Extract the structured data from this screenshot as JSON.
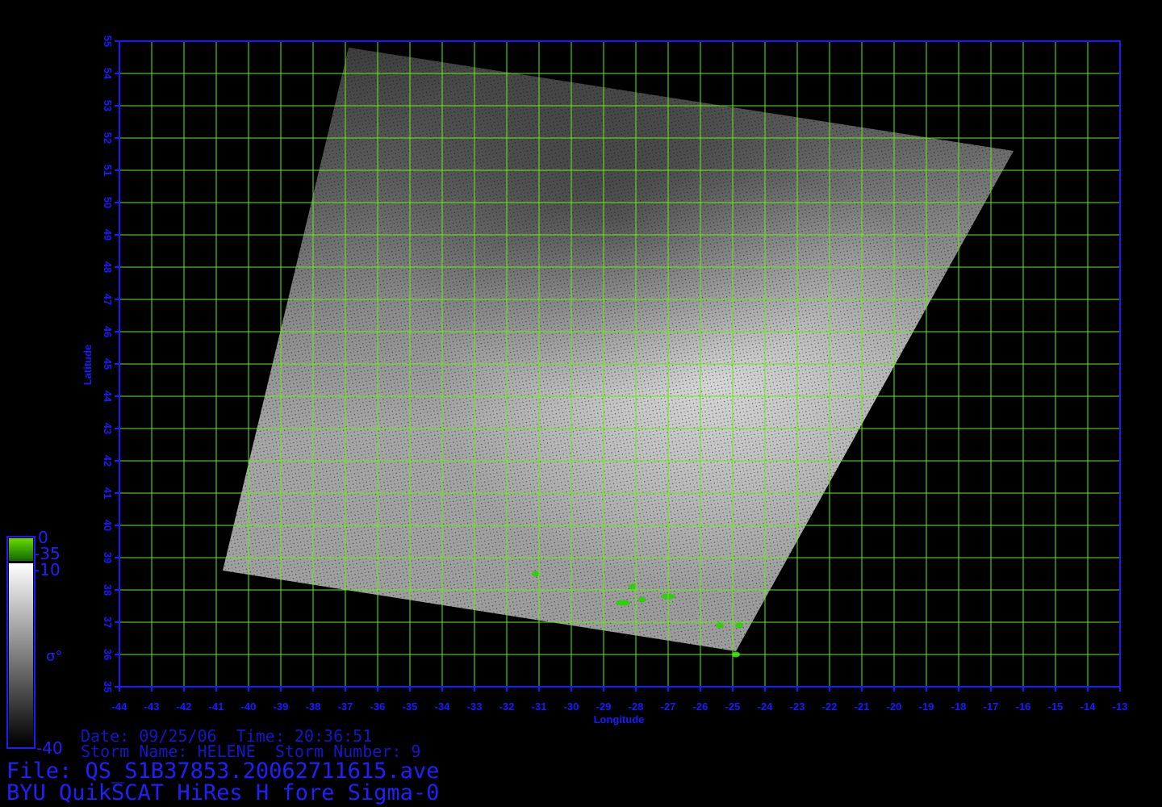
{
  "map": {
    "lon_range": [
      -44,
      -13
    ],
    "lat_range": [
      35,
      55
    ],
    "lon_ticks": [
      -44,
      -43,
      -42,
      -41,
      -40,
      -39,
      -38,
      -37,
      -36,
      -35,
      -34,
      -33,
      -32,
      -31,
      -30,
      -29,
      -28,
      -27,
      -26,
      -25,
      -24,
      -23,
      -22,
      -21,
      -20,
      -19,
      -18,
      -17,
      -16,
      -15,
      -14,
      -13
    ],
    "lat_ticks": [
      35,
      36,
      37,
      38,
      39,
      40,
      41,
      42,
      43,
      44,
      45,
      46,
      47,
      48,
      49,
      50,
      51,
      52,
      53,
      54,
      55
    ],
    "grid_step_deg": 1,
    "swath_corners_lonlat": [
      [
        -36.9,
        54.8
      ],
      [
        -16.3,
        51.6
      ],
      [
        -24.9,
        36.1
      ],
      [
        -40.8,
        38.6
      ]
    ],
    "land_patches_lonlat": [
      [
        -31.1,
        38.5
      ],
      [
        -28.4,
        37.6
      ],
      [
        -27.8,
        37.7
      ],
      [
        -27.0,
        37.8
      ],
      [
        -28.1,
        38.1
      ],
      [
        -25.4,
        36.9
      ],
      [
        -24.8,
        36.9
      ],
      [
        -24.9,
        36.0
      ]
    ],
    "colors": {
      "frame": "#1a1aff",
      "grid": "#66ee11",
      "land": "#33cc11",
      "background": "#000000"
    }
  },
  "labels": {
    "x_axis": "Longitude",
    "y_axis": "Latitude"
  },
  "colorbar": {
    "ticks": [
      "0",
      "-35",
      "-10",
      "-40"
    ],
    "symbol": "σ°",
    "land_range": [
      -35,
      0
    ],
    "ocean_range": [
      -40,
      -10
    ]
  },
  "footer": {
    "date_line": "Date: 09/25/06  Time: 20:36:51",
    "storm_line": "Storm Name: HELENE  Storm Number: 9",
    "file_line": "File: QS_S1B37853.20062711615.ave",
    "product_line": "BYU QuikSCAT HiRes H fore Sigma-0"
  }
}
